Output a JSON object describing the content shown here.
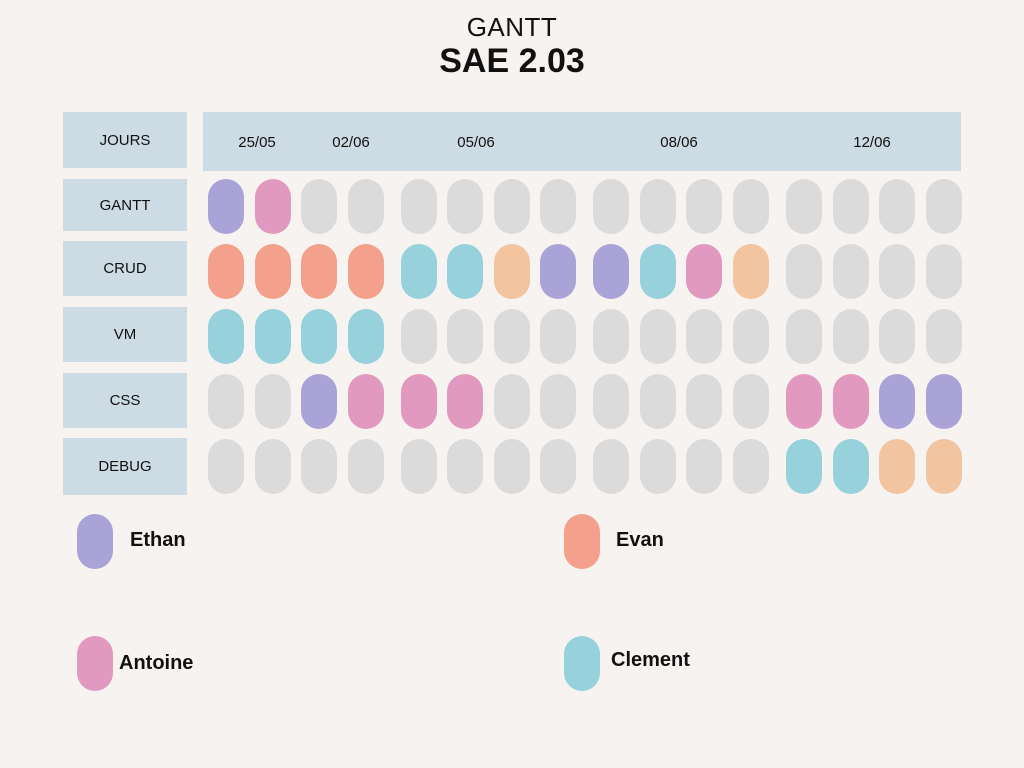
{
  "title": "GANTT",
  "subtitle": "SAE 2.03",
  "header_label": "JOURS",
  "dates": [
    "25/05",
    "02/06",
    "05/06",
    "08/06",
    "12/06"
  ],
  "colors": {
    "empty": "#dbdbdb",
    "ethan": "#a9a3d7",
    "antoine": "#e299bf",
    "evan": "#f3a08c",
    "clement": "#96d1dc",
    "peach": "#f2c4a0"
  },
  "tasks": [
    {
      "label": "GANTT",
      "cells": [
        "ethan",
        "antoine",
        "empty",
        "empty",
        "empty",
        "empty",
        "empty",
        "empty",
        "empty",
        "empty",
        "empty",
        "empty",
        "empty",
        "empty",
        "empty",
        "empty"
      ]
    },
    {
      "label": "CRUD",
      "cells": [
        "evan",
        "evan",
        "evan",
        "evan",
        "clement",
        "clement",
        "peach",
        "ethan",
        "ethan",
        "clement",
        "antoine",
        "peach",
        "empty",
        "empty",
        "empty",
        "empty"
      ]
    },
    {
      "label": "VM",
      "cells": [
        "clement",
        "clement",
        "clement",
        "clement",
        "empty",
        "empty",
        "empty",
        "empty",
        "empty",
        "empty",
        "empty",
        "empty",
        "empty",
        "empty",
        "empty",
        "empty"
      ]
    },
    {
      "label": "CSS",
      "cells": [
        "empty",
        "empty",
        "ethan",
        "antoine",
        "antoine",
        "antoine",
        "empty",
        "empty",
        "empty",
        "empty",
        "empty",
        "empty",
        "antoine",
        "antoine",
        "ethan",
        "ethan"
      ]
    },
    {
      "label": "DEBUG",
      "cells": [
        "empty",
        "empty",
        "empty",
        "empty",
        "empty",
        "empty",
        "empty",
        "empty",
        "empty",
        "empty",
        "empty",
        "empty",
        "clement",
        "clement",
        "peach",
        "peach"
      ]
    }
  ],
  "legend": [
    {
      "name": "Ethan",
      "color": "ethan"
    },
    {
      "name": "Evan",
      "color": "evan"
    },
    {
      "name": "Antoine",
      "color": "antoine"
    },
    {
      "name": "Clement",
      "color": "clement"
    }
  ]
}
